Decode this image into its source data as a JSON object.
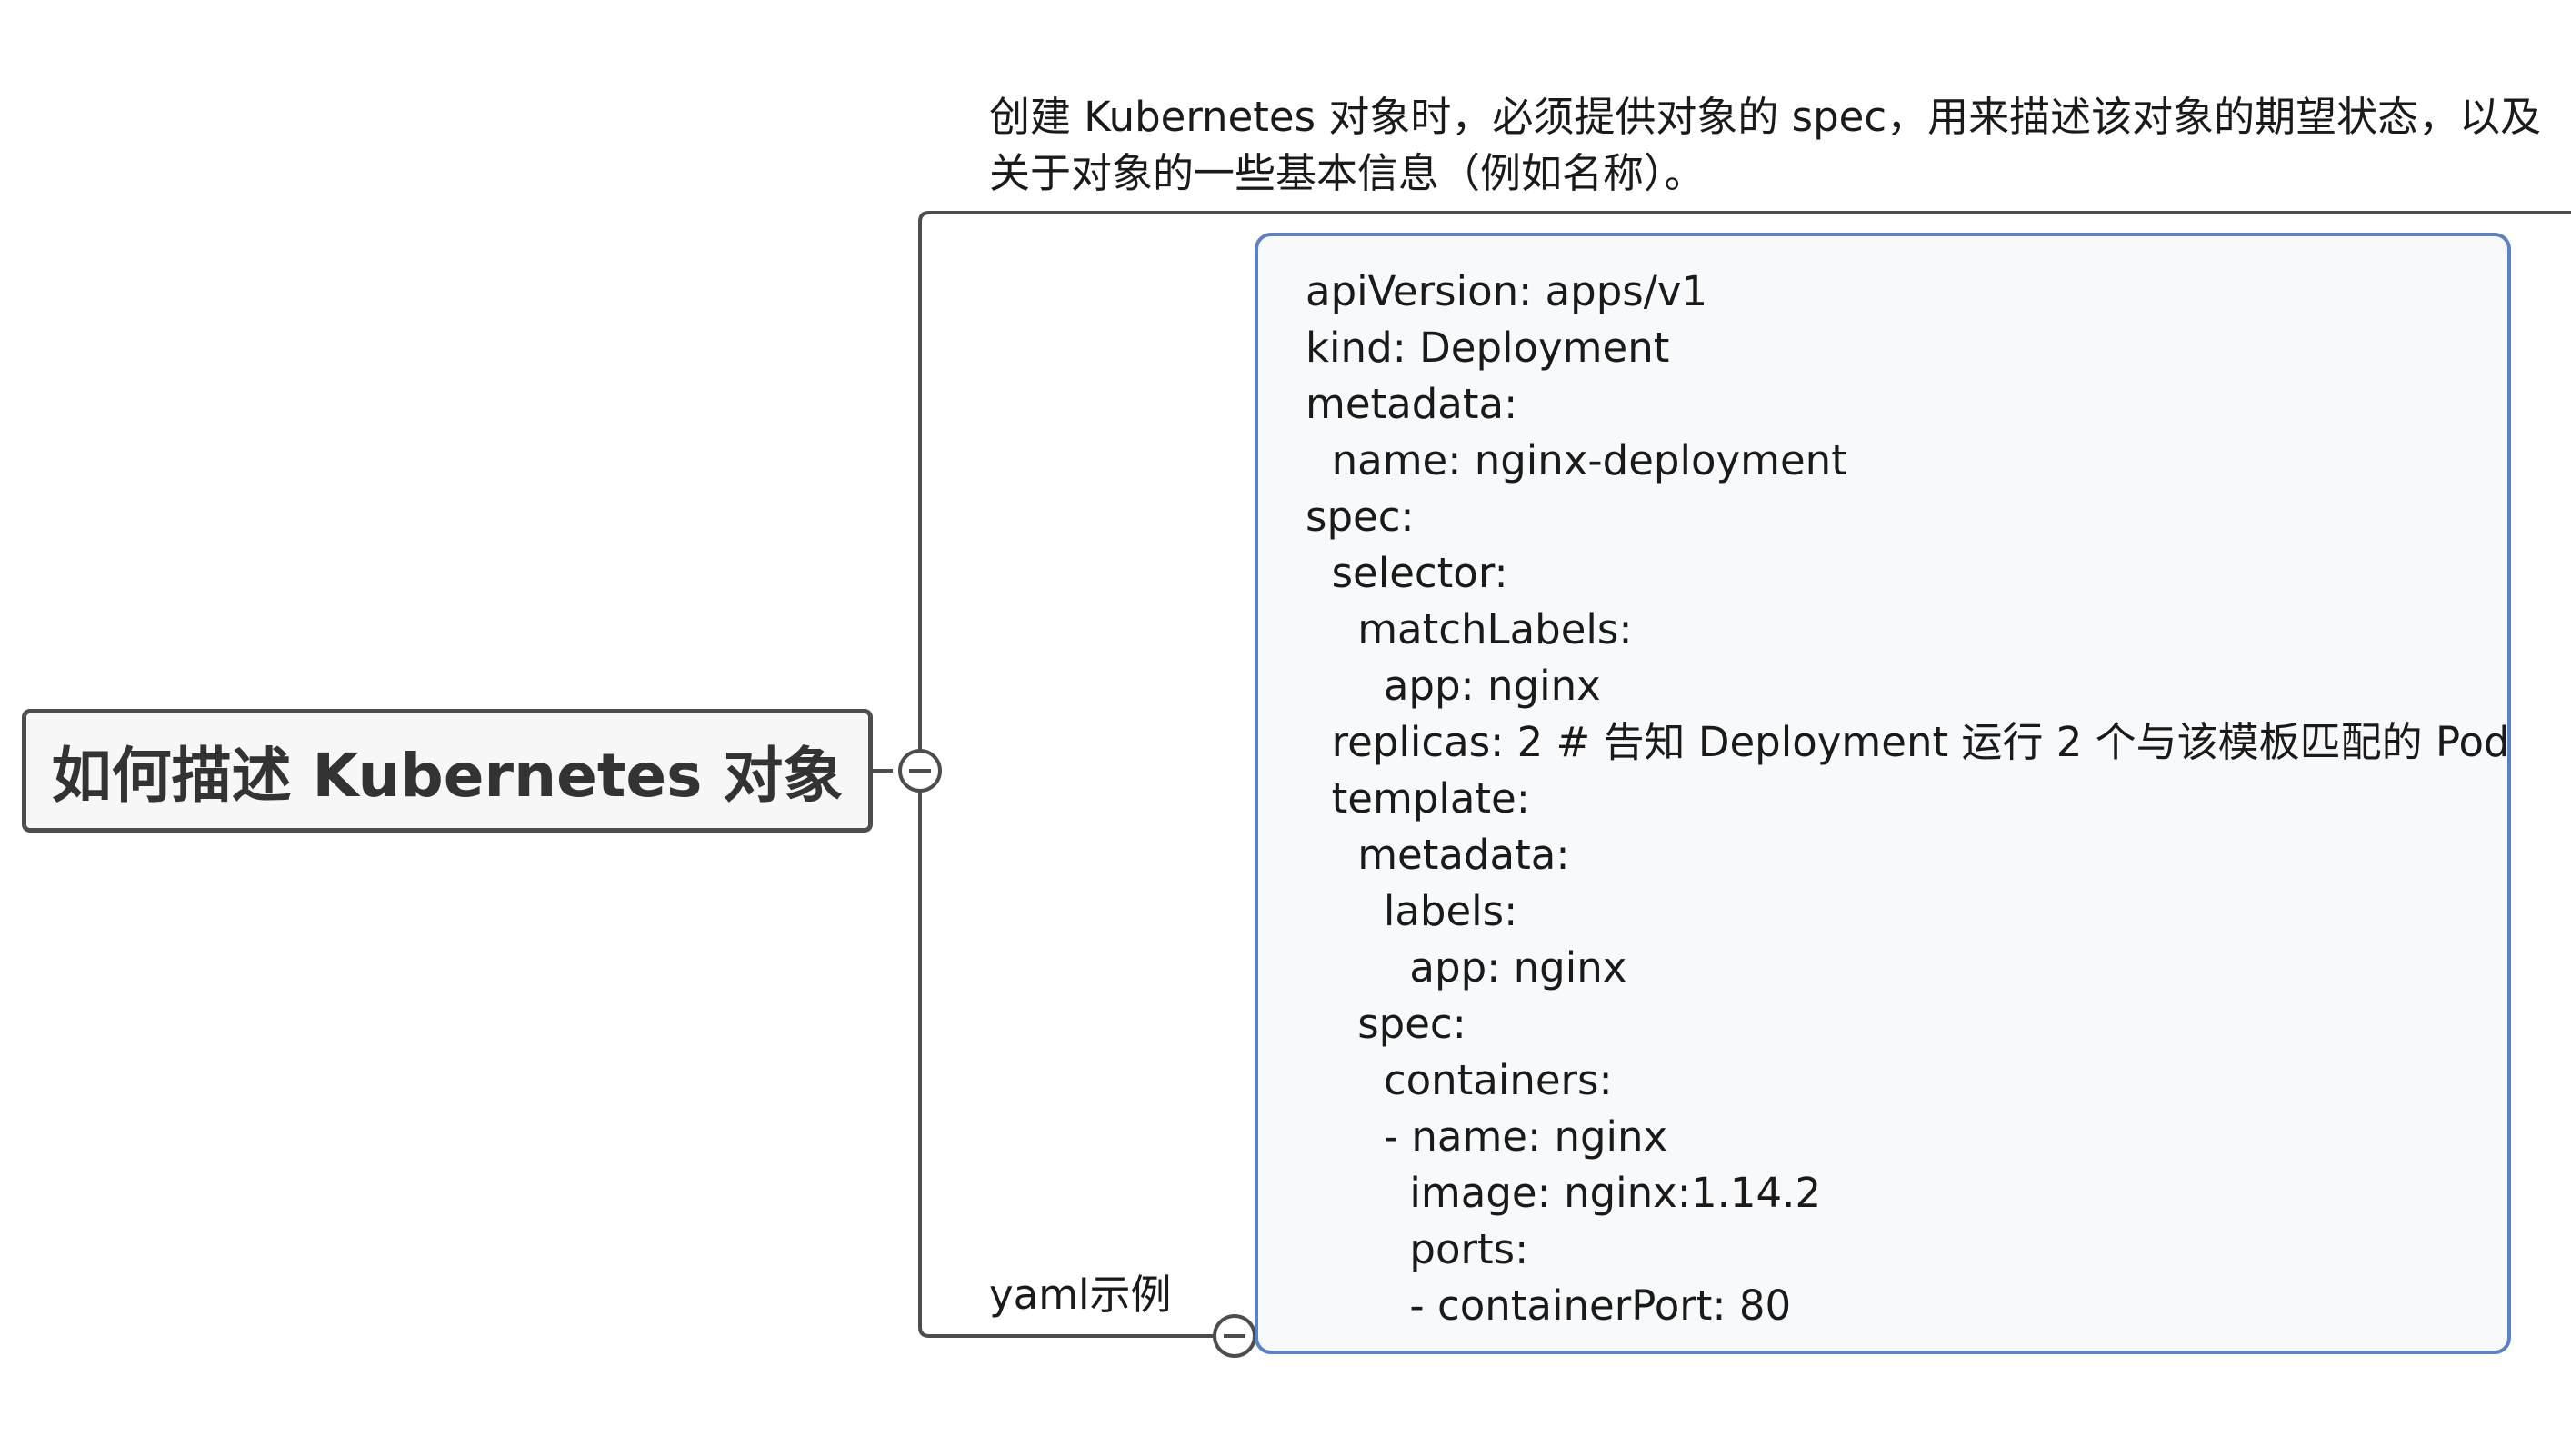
{
  "root": {
    "label": "如何描述 Kubernetes 对象"
  },
  "branches": {
    "description": {
      "lines": [
        "创建 Kubernetes 对象时，必须提供对象的 spec，用来描述该对象的期望状态，以及",
        "关于对象的一些基本信息（例如名称）。"
      ]
    },
    "yaml": {
      "label": "yaml示例",
      "code_lines": [
        "apiVersion: apps/v1",
        "kind: Deployment",
        "metadata:",
        "  name: nginx-deployment",
        "spec:",
        "  selector:",
        "    matchLabels:",
        "      app: nginx",
        "  replicas: 2 # 告知 Deployment 运行 2 个与该模板匹配的 Pod",
        "  template:",
        "    metadata:",
        "      labels:",
        "        app: nginx",
        "    spec:",
        "      containers:",
        "      - name: nginx",
        "        image: nginx:1.14.2",
        "        ports:",
        "        - containerPort: 80"
      ]
    }
  },
  "colors": {
    "connector": "#4d4d4d",
    "code_box_border": "#5b82c6",
    "code_box_bg": "#f7f9fb",
    "root_border": "#4d4d4d",
    "root_bg": "#f7f7f7"
  },
  "icons": {
    "root_collapse": "minus-circle-icon",
    "yaml_collapse": "minus-circle-icon"
  }
}
